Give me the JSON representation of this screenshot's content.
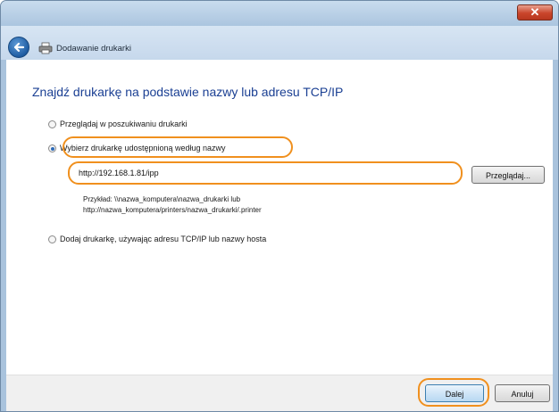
{
  "window": {
    "title": "Dodawanie drukarki",
    "close_symbol": "✕"
  },
  "main": {
    "heading": "Znajdź drukarkę na podstawie nazwy lub adresu TCP/IP",
    "options": [
      {
        "label": "Przeglądaj w poszukiwaniu drukarki",
        "selected": false
      },
      {
        "label": "Wybierz drukarkę udostępnioną według nazwy",
        "selected": true
      },
      {
        "label": "Dodaj drukarkę, używając adresu TCP/IP lub nazwy hosta",
        "selected": false
      }
    ],
    "shared_printer_name": {
      "value": "http://192.168.1.81/ipp"
    },
    "browse_label": "Przeglądaj...",
    "example_line1": "Przykład: \\\\nazwa_komputera\\nazwa_drukarki lub",
    "example_line2": "http://nazwa_komputera/printers/nazwa_drukarki/.printer"
  },
  "footer": {
    "next_label": "Dalej",
    "cancel_label": "Anuluj"
  },
  "colors": {
    "highlight": "#f0901e",
    "heading": "#1a3f93"
  }
}
